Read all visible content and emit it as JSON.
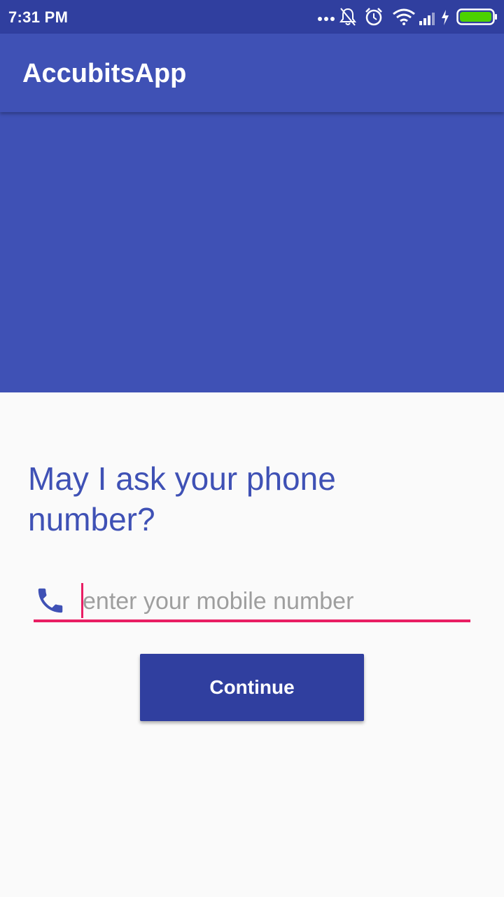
{
  "status_bar": {
    "time": "7:31 PM",
    "icons": [
      "more-dots-icon",
      "notifications-off-icon",
      "alarm-icon",
      "wifi-icon",
      "signal-icon",
      "charging-icon",
      "battery-icon"
    ]
  },
  "app_bar": {
    "title": "AccubitsApp"
  },
  "main": {
    "question": "May I ask your phone number?",
    "phone_input": {
      "value": "",
      "placeholder": "enter your mobile number",
      "icon": "phone-icon"
    },
    "continue_label": "Continue"
  },
  "colors": {
    "primary": "#3f51b5",
    "primary_dark": "#303f9f",
    "accent": "#e91e63",
    "background": "#fafafa",
    "battery": "#4cd200"
  }
}
